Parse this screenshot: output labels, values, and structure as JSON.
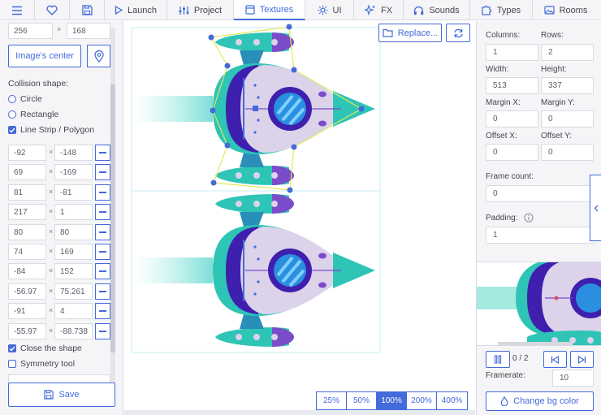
{
  "nav": {
    "tabs": [
      {
        "label": "Launch",
        "icon": "play-icon"
      },
      {
        "label": "Project",
        "icon": "sliders-icon"
      },
      {
        "label": "Textures",
        "icon": "texture-icon",
        "active": true
      },
      {
        "label": "UI",
        "icon": "sun-icon"
      },
      {
        "label": "FX",
        "icon": "sparkles-icon"
      },
      {
        "label": "Sounds",
        "icon": "headphones-icon"
      },
      {
        "label": "Types",
        "icon": "puzzle-icon"
      },
      {
        "label": "Rooms",
        "icon": "image-icon"
      }
    ]
  },
  "left": {
    "size_w": "256",
    "size_h": "168",
    "image_center_label": "Image's center",
    "collision_label": "Collision shape:",
    "shape_options": [
      {
        "label": "Circle",
        "selected": false
      },
      {
        "label": "Rectangle",
        "selected": false
      },
      {
        "label": "Line Strip / Polygon",
        "selected": true
      }
    ],
    "points": [
      {
        "x": "-92",
        "y": "-148"
      },
      {
        "x": "69",
        "y": "-169"
      },
      {
        "x": "81",
        "y": "-81"
      },
      {
        "x": "217",
        "y": "1"
      },
      {
        "x": "80",
        "y": "80"
      },
      {
        "x": "74",
        "y": "169"
      },
      {
        "x": "-84",
        "y": "152"
      },
      {
        "x": "-56.97",
        "y": "75.261"
      },
      {
        "x": "-91",
        "y": "4"
      },
      {
        "x": "-55.97",
        "y": "-88.738"
      }
    ],
    "close_shape_label": "Close the shape",
    "symmetry_label": "Symmetry tool",
    "save_label": "Save"
  },
  "canvas": {
    "replace_label": "Replace...",
    "zoom_options": [
      "25%",
      "50%",
      "100%",
      "200%",
      "400%"
    ],
    "zoom_active": "100%"
  },
  "right": {
    "columns_label": "Columns:",
    "columns": "1",
    "rows_label": "Rows:",
    "rows": "2",
    "width_label": "Width:",
    "width": "513",
    "height_label": "Height:",
    "height": "337",
    "margin_x_label": "Margin X:",
    "margin_x": "0",
    "margin_y_label": "Margin Y:",
    "margin_y": "0",
    "offset_x_label": "Offset X:",
    "offset_x": "0",
    "offset_y_label": "Offset Y:",
    "offset_y": "0",
    "frame_count_label": "Frame count:",
    "frame_count": "0",
    "padding_label": "Padding:",
    "padding": "1",
    "frame_counter": "0 / 2",
    "framerate_label": "Framerate:",
    "framerate": "10",
    "change_bg_label": "Change bg color"
  },
  "colors": {
    "accent": "#446adb",
    "panel_bg": "#f5f5f7",
    "teal": "#2ec4b6",
    "purple": "#3f1fae",
    "hull": "#dcd3ea",
    "polygon": "#e3e85a"
  }
}
